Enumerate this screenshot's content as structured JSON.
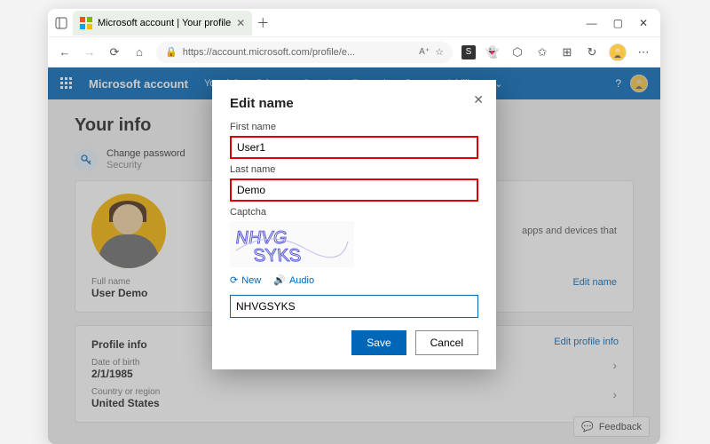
{
  "browser": {
    "tab_title": "Microsoft account | Your profile",
    "url": "https://account.microsoft.com/profile/e..."
  },
  "header": {
    "brand": "Microsoft account",
    "nav": [
      "Your info",
      "Privacy",
      "Security",
      "Rewards",
      "Payment & billing"
    ]
  },
  "page": {
    "title": "Your info",
    "change_password": "Change password",
    "change_password_sub": "Security",
    "full_name_label": "Full name",
    "full_name_value": "User Demo",
    "edit_name_link": "Edit name",
    "profile_info_title": "Profile info",
    "edit_profile_link": "Edit profile info",
    "dob_label": "Date of birth",
    "dob_value": "2/1/1985",
    "country_label": "Country or region",
    "country_value": "United States",
    "side_text": "apps and devices that",
    "feedback": "Feedback"
  },
  "modal": {
    "title": "Edit name",
    "first_label": "First name",
    "first_value": "User1",
    "last_label": "Last name",
    "last_value": "Demo",
    "captcha_label": "Captcha",
    "captcha_new": "New",
    "captcha_audio": "Audio",
    "captcha_value": "NHVGSYKS",
    "save": "Save",
    "cancel": "Cancel"
  }
}
